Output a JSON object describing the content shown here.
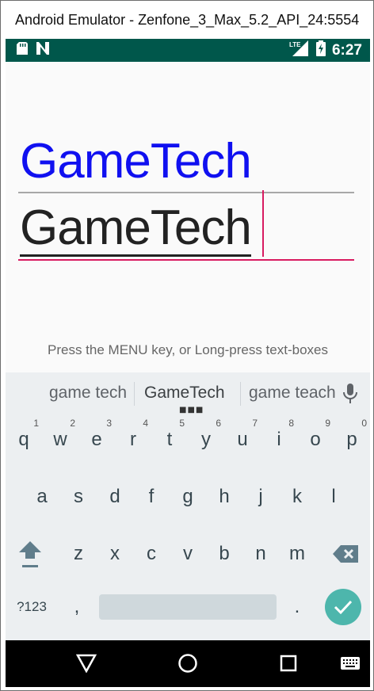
{
  "window": {
    "title": "Android Emulator - Zenfone_3_Max_5.2_API_24:5554"
  },
  "status_bar": {
    "time": "6:27",
    "lte_label": "LTE"
  },
  "app": {
    "title": "GameTech",
    "edit_value": "GameTech",
    "hint": "Press the MENU key, or Long-press text-boxes"
  },
  "keyboard": {
    "suggestions": [
      "game tech",
      "GameTech",
      "game teach"
    ],
    "rows": [
      [
        {
          "k": "q",
          "n": "1"
        },
        {
          "k": "w",
          "n": "2"
        },
        {
          "k": "e",
          "n": "3"
        },
        {
          "k": "r",
          "n": "4"
        },
        {
          "k": "t",
          "n": "5"
        },
        {
          "k": "y",
          "n": "6"
        },
        {
          "k": "u",
          "n": "7"
        },
        {
          "k": "i",
          "n": "8"
        },
        {
          "k": "o",
          "n": "9"
        },
        {
          "k": "p",
          "n": "0"
        }
      ],
      [
        {
          "k": "a"
        },
        {
          "k": "s"
        },
        {
          "k": "d"
        },
        {
          "k": "f"
        },
        {
          "k": "g"
        },
        {
          "k": "h"
        },
        {
          "k": "j"
        },
        {
          "k": "k"
        },
        {
          "k": "l"
        }
      ],
      [
        {
          "k": "z"
        },
        {
          "k": "x"
        },
        {
          "k": "c"
        },
        {
          "k": "v"
        },
        {
          "k": "b"
        },
        {
          "k": "n"
        },
        {
          "k": "m"
        }
      ]
    ],
    "symbols_key": "?123",
    "comma": ",",
    "period": "."
  },
  "colors": {
    "status_bar": "#00574b",
    "title_text": "#1010f0",
    "accent": "#d81b60",
    "enter_key": "#4db6ac"
  }
}
